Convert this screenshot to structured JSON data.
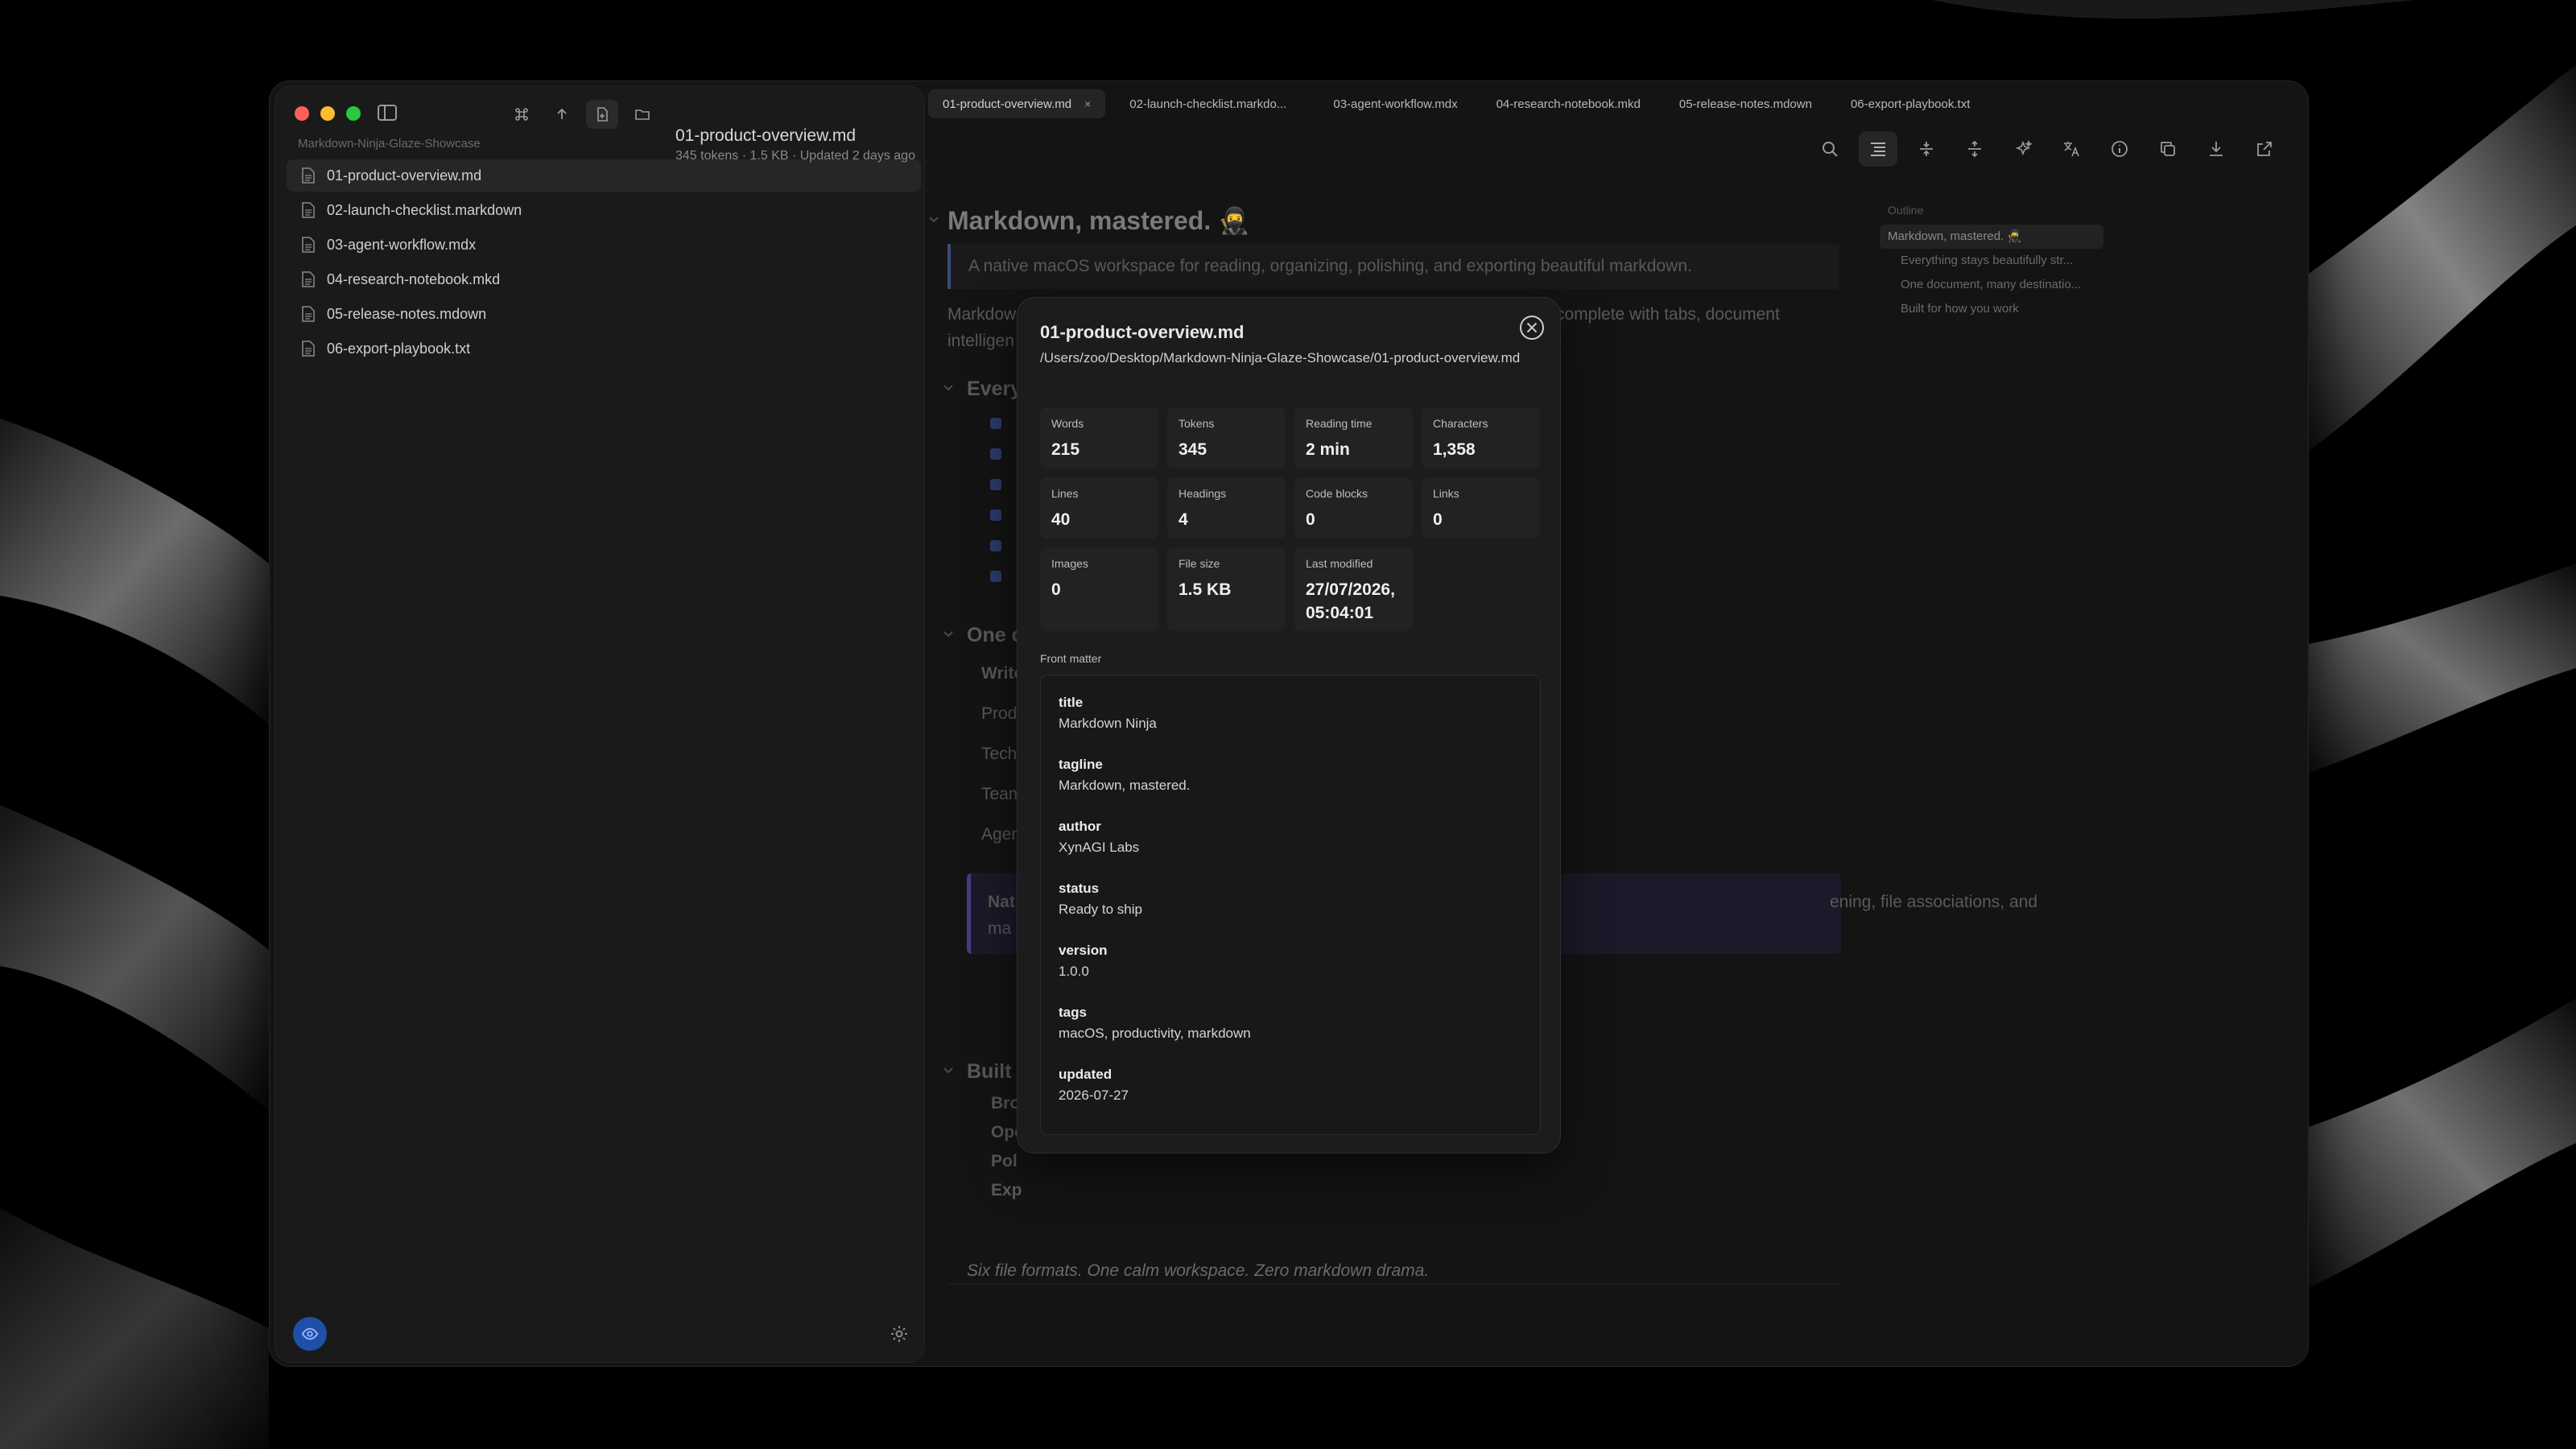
{
  "sidebar": {
    "folder": "Markdown-Ninja-Glaze-Showcase",
    "files": [
      {
        "name": "01-product-overview.md",
        "active": true
      },
      {
        "name": "02-launch-checklist.markdown",
        "active": false
      },
      {
        "name": "03-agent-workflow.mdx",
        "active": false
      },
      {
        "name": "04-research-notebook.mkd",
        "active": false
      },
      {
        "name": "05-release-notes.mdown",
        "active": false
      },
      {
        "name": "06-export-playbook.txt",
        "active": false
      }
    ]
  },
  "tabs": [
    {
      "label": "01-product-overview.md",
      "active": true,
      "close": "×"
    },
    {
      "label": "02-launch-checklist.markdo...",
      "active": false
    },
    {
      "label": "03-agent-workflow.mdx",
      "active": false
    },
    {
      "label": "04-research-notebook.mkd",
      "active": false
    },
    {
      "label": "05-release-notes.mdown",
      "active": false
    },
    {
      "label": "06-export-playbook.txt",
      "active": false
    }
  ],
  "document": {
    "title": "01-product-overview.md",
    "meta": "345 tokens · 1.5 KB · Updated 2 days ago",
    "h1": "Markdown, mastered. 🥷",
    "tagline": "A native macOS workspace for reading, organizing, polishing, and exporting beautiful markdown.",
    "para_start": "Markdow",
    "para_end": "complete with tabs, document",
    "para_line2": "intelligen",
    "h2_1": "Every",
    "h2_2": "One c",
    "table_rows": [
      "Write",
      "Prod",
      "Tech",
      "Team",
      "Agen"
    ],
    "callout_start": "Nat",
    "callout_end": "ening, file associations, and",
    "callout_line2": "ma",
    "h2_3": "Built f",
    "list_rows": [
      "Bro",
      "Ope",
      "Pol",
      "Exp"
    ],
    "closing": "Six file formats. One calm workspace. Zero markdown drama."
  },
  "outline": {
    "title": "Outline",
    "items": [
      {
        "label": "Markdown, mastered. 🥷",
        "active": true,
        "sub": false
      },
      {
        "label": "Everything stays beautifully str...",
        "active": false,
        "sub": true
      },
      {
        "label": "One document, many destinatio...",
        "active": false,
        "sub": true
      },
      {
        "label": "Built for how you work",
        "active": false,
        "sub": true
      }
    ]
  },
  "modal": {
    "title": "01-product-overview.md",
    "path": "/Users/zoo/Desktop/Markdown-Ninja-Glaze-Showcase/01-product-overview.md",
    "stats": [
      {
        "label": "Words",
        "value": "215"
      },
      {
        "label": "Tokens",
        "value": "345"
      },
      {
        "label": "Reading time",
        "value": "2 min"
      },
      {
        "label": "Characters",
        "value": "1,358"
      },
      {
        "label": "Lines",
        "value": "40"
      },
      {
        "label": "Headings",
        "value": "4"
      },
      {
        "label": "Code blocks",
        "value": "0"
      },
      {
        "label": "Links",
        "value": "0"
      },
      {
        "label": "Images",
        "value": "0"
      },
      {
        "label": "File size",
        "value": "1.5 KB"
      },
      {
        "label": "Last modified",
        "value": "27/07/2026, 05:04:01"
      }
    ],
    "front_matter_label": "Front matter",
    "front_matter": [
      {
        "key": "title",
        "value": "Markdown Ninja"
      },
      {
        "key": "tagline",
        "value": "Markdown, mastered."
      },
      {
        "key": "author",
        "value": "XynAGI Labs"
      },
      {
        "key": "status",
        "value": "Ready to ship"
      },
      {
        "key": "version",
        "value": "1.0.0"
      },
      {
        "key": "tags",
        "value": "macOS, productivity, markdown"
      },
      {
        "key": "updated",
        "value": "2026-07-27"
      }
    ]
  },
  "colors": {
    "accent": "#1f4fa8",
    "callout": "#4a3a8a",
    "tl_red": "#fe5f57",
    "tl_yellow": "#febc2e",
    "tl_green": "#28c840"
  },
  "icons": {
    "toolbar": [
      "search-icon",
      "outline-icon",
      "collapse-icon",
      "expand-icon",
      "sparkle-icon",
      "translate-icon",
      "info-icon",
      "copy-icon",
      "download-icon",
      "share-icon"
    ]
  }
}
